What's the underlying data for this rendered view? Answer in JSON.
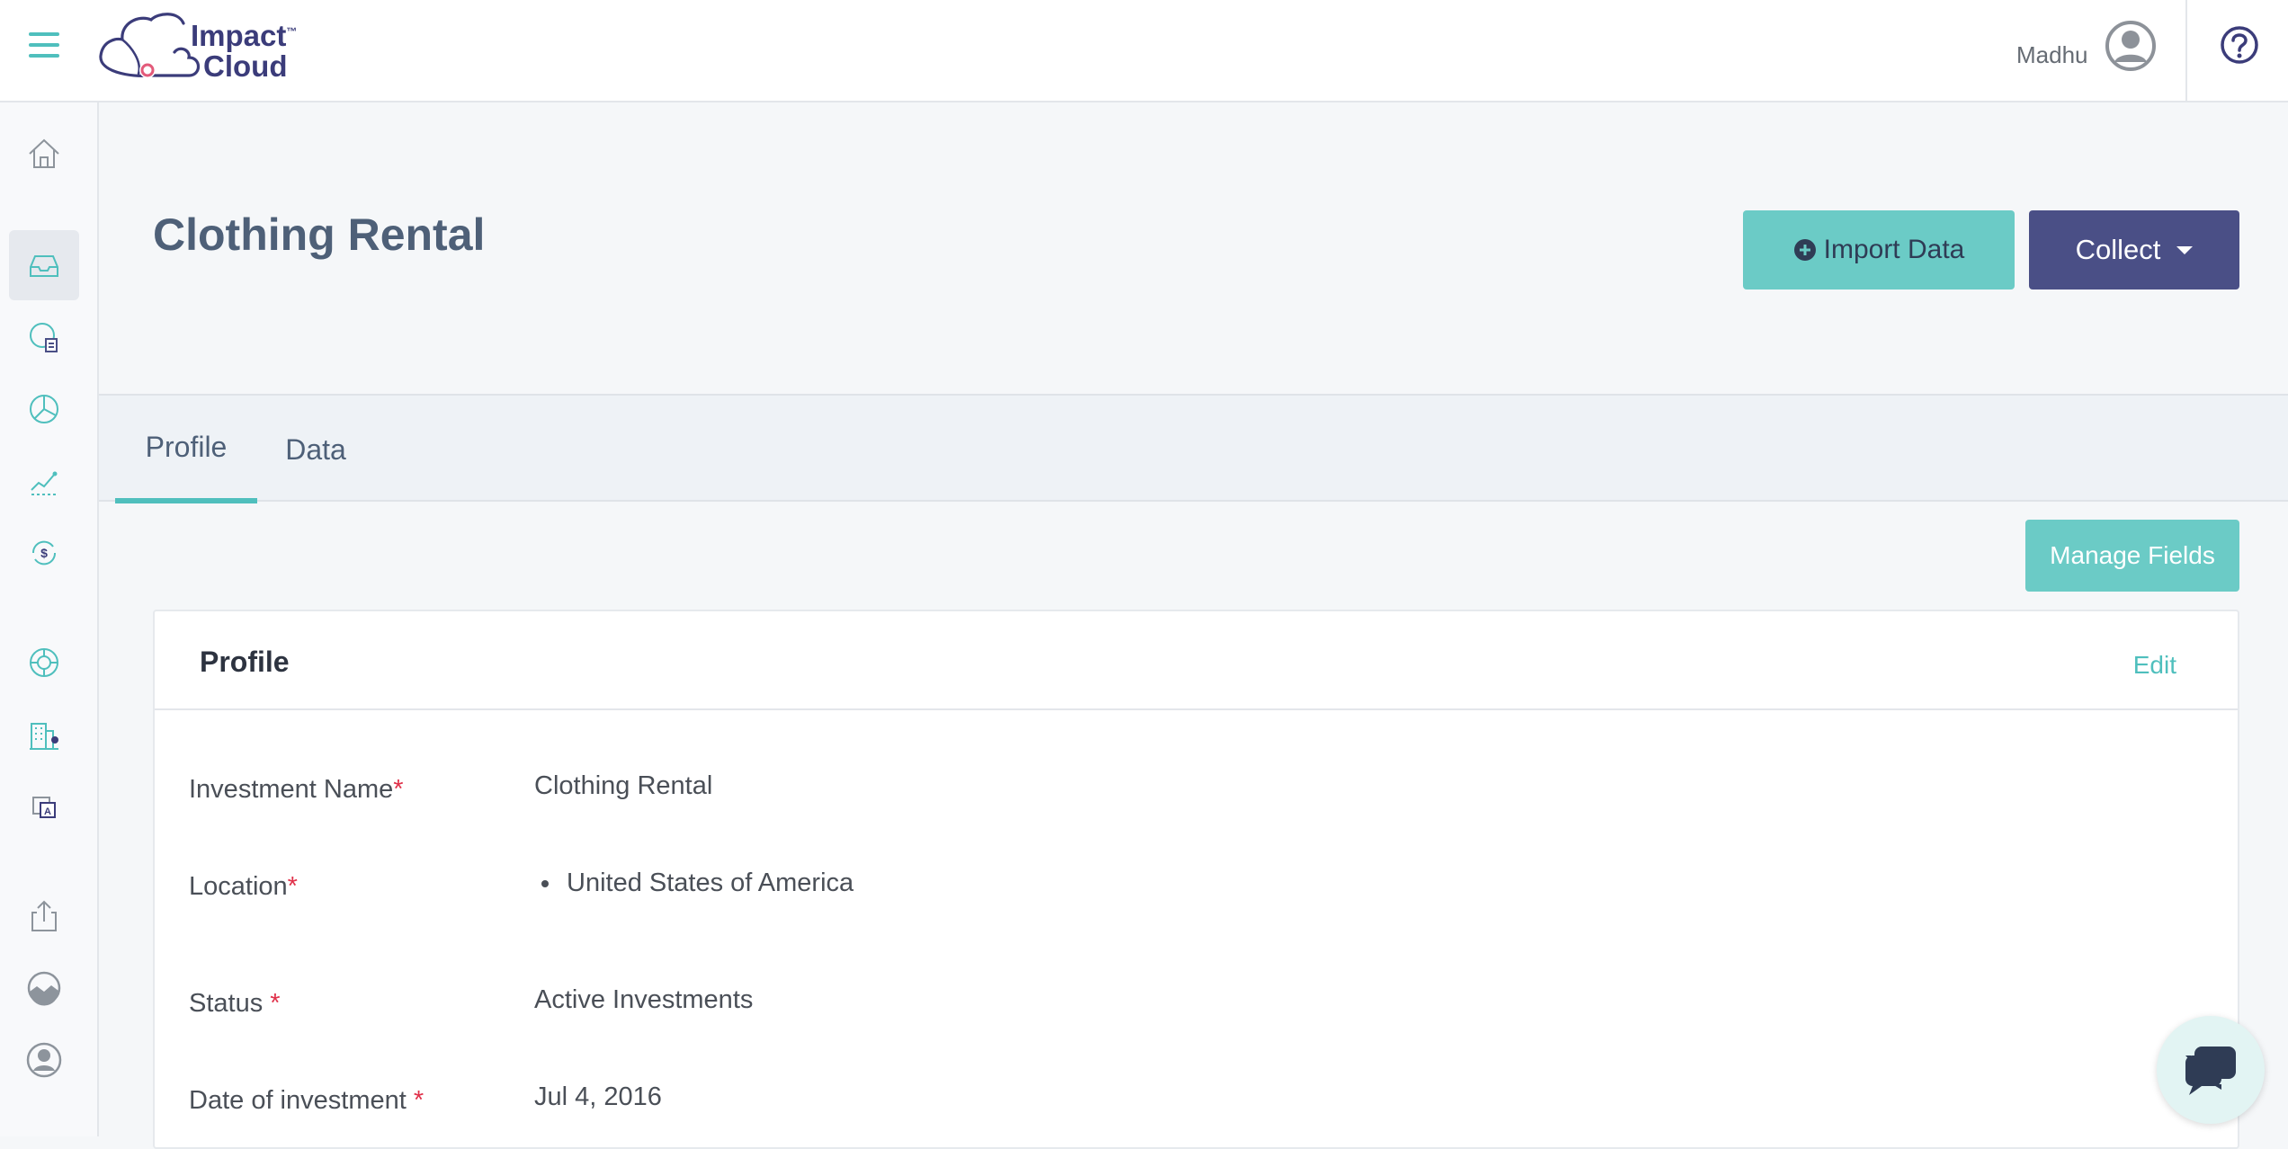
{
  "header": {
    "logo_line1": "Impact",
    "logo_line2": "Cloud",
    "logo_tm": "™",
    "user_name": "Madhu"
  },
  "page": {
    "title": "Clothing Rental",
    "import_label": "Import Data",
    "collect_label": "Collect",
    "manage_fields_label": "Manage Fields"
  },
  "tabs": [
    {
      "label": "Profile",
      "active": true
    },
    {
      "label": "Data",
      "active": false
    }
  ],
  "profile_card": {
    "title": "Profile",
    "edit_label": "Edit",
    "required_marker": "*",
    "fields": [
      {
        "label": "Investment Name",
        "value": "Clothing Rental"
      },
      {
        "label": "Location",
        "value": "United States of America"
      },
      {
        "label": "Status ",
        "value": "Active Investments"
      },
      {
        "label": "Date of investment ",
        "value": "Jul 4, 2016"
      }
    ]
  },
  "sidebar": {
    "items": [
      "home-icon",
      "inbox-icon",
      "survey-icon",
      "pie-chart-icon",
      "trend-chart-icon",
      "finance-icon",
      "support-icon",
      "building-icon",
      "translate-icon",
      "export-icon",
      "landscape-icon",
      "user-account-icon"
    ],
    "active": "inbox-icon"
  },
  "colors": {
    "accent": "#4fbfbd",
    "teal_button": "#6bcbc6",
    "collect_button": "#4a4f86",
    "title": "#4e6078",
    "required": "#e0314a"
  }
}
